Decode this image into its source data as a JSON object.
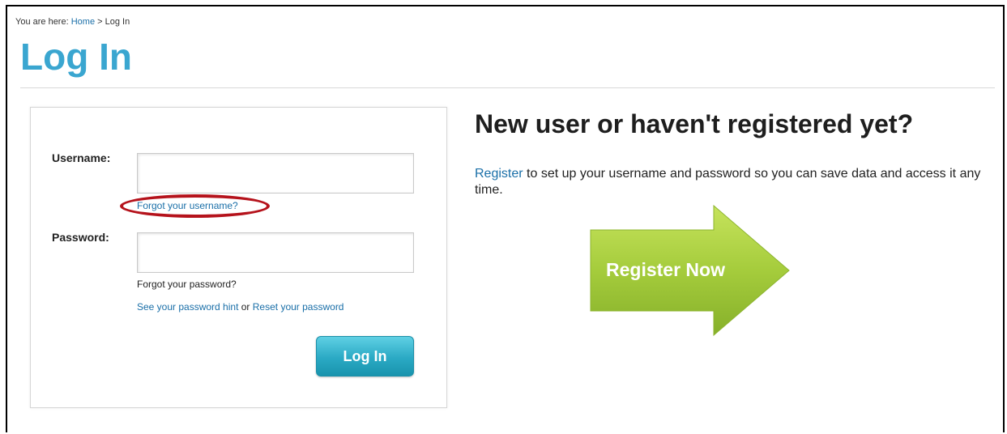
{
  "breadcrumb": {
    "prefix": "You are here:",
    "home": "Home",
    "separator": ">",
    "current": "Log In"
  },
  "page": {
    "title": "Log In"
  },
  "login": {
    "username_label": "Username:",
    "username_value": "",
    "forgot_username": "Forgot your username?",
    "password_label": "Password:",
    "password_value": "",
    "forgot_password": "Forgot your password?",
    "password_hint": "See your password hint",
    "or": "or",
    "reset_password": "Reset your password",
    "submit_label": "Log In"
  },
  "register": {
    "heading": "New user or haven't registered yet?",
    "link": "Register",
    "description": "to set up your username and password so you can save data and access it any time.",
    "cta_label": "Register Now"
  },
  "colors": {
    "title": "#3aa6d0",
    "link": "#1a6fa8",
    "highlight": "#b5121b",
    "button": "#2aa9c4",
    "arrow": "#9cc83a"
  }
}
